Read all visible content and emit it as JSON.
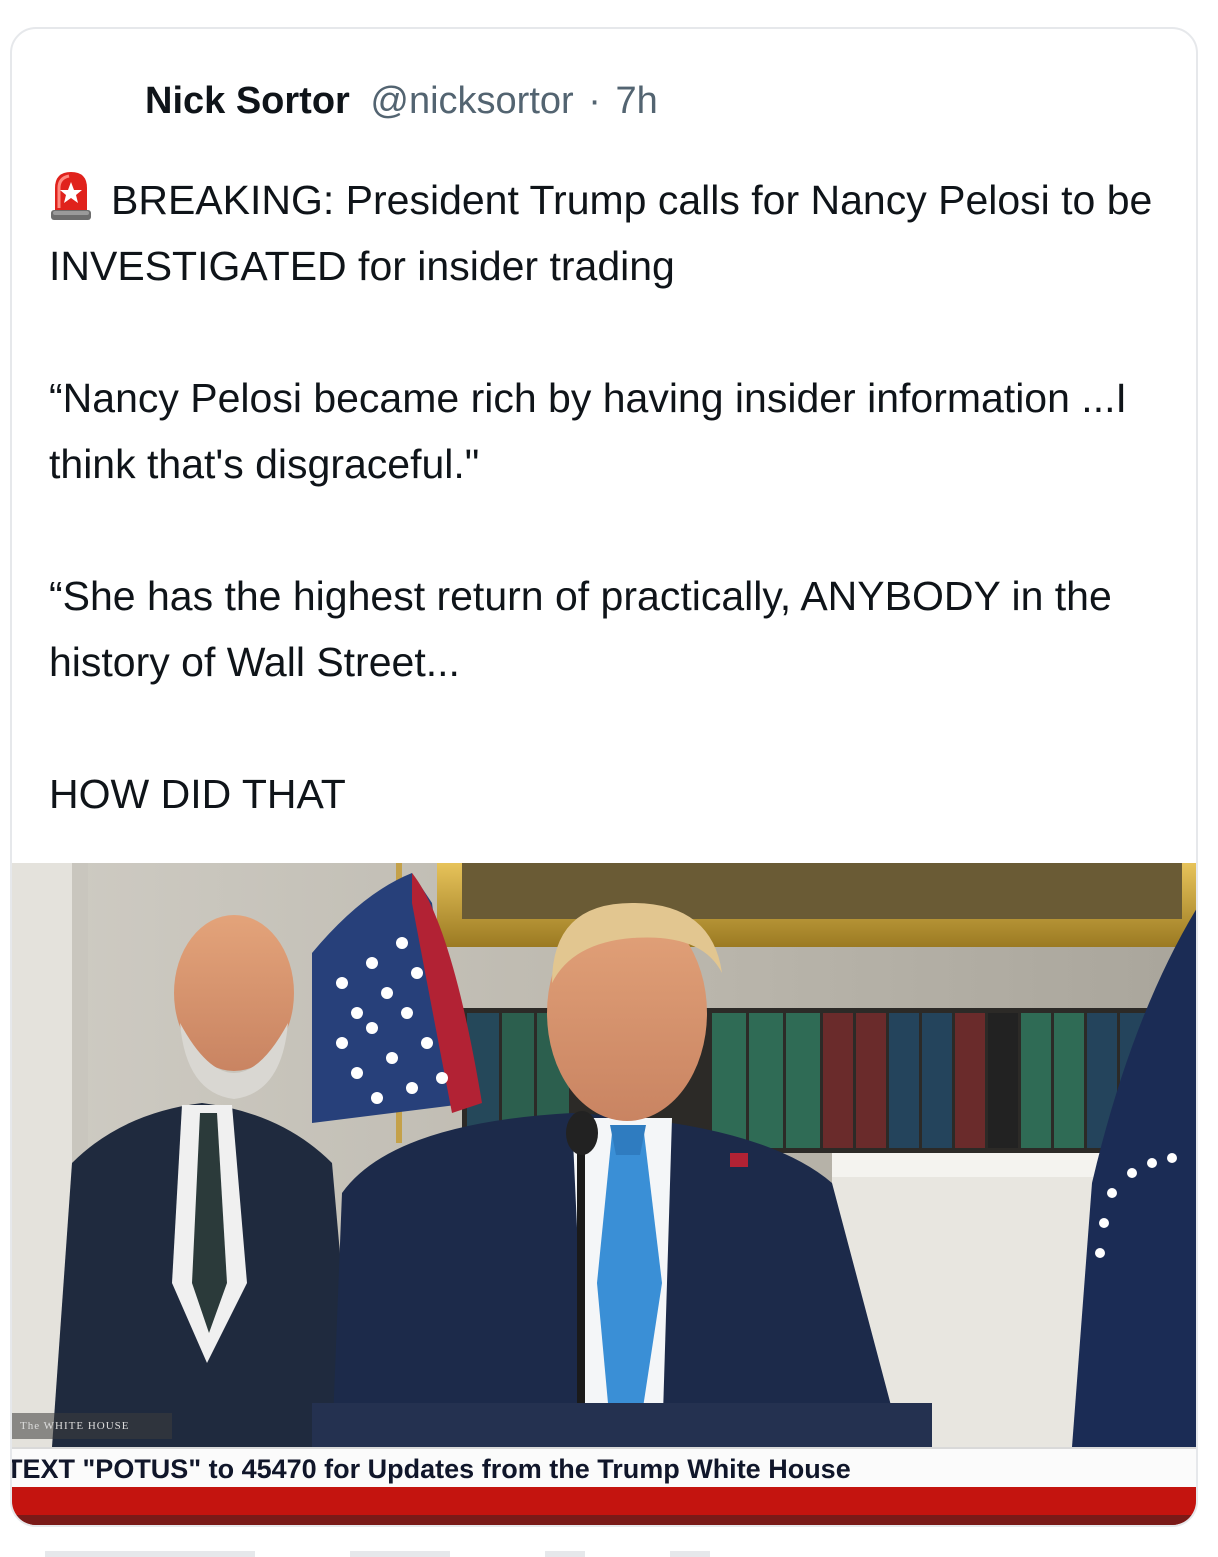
{
  "post": {
    "author": "Nick Sortor",
    "handle": "@nicksortor",
    "separator": "·",
    "time": "7h",
    "icon": "rotating-light-emoji",
    "paragraphs": [
      "BREAKING: President Trump calls for Nancy Pelosi to be INVESTIGATED for insider trading",
      "“Nancy Pelosi became rich by having insider information ...I think that's disgraceful.\"",
      "“She has the highest return of practically, ANYBODY in the history of Wall Street...",
      "HOW DID THAT"
    ]
  },
  "media": {
    "network_bug": "The WHITE HOUSE",
    "ticker": "TEXT \"POTUS\" to 45470 for Updates from the Trump White House"
  },
  "colors": {
    "text_primary": "#0f1419",
    "text_secondary": "#536471",
    "ticker_red": "#c4140f",
    "tie_blue": "#3a8fd6",
    "suit_navy": "#1c2a4a"
  }
}
